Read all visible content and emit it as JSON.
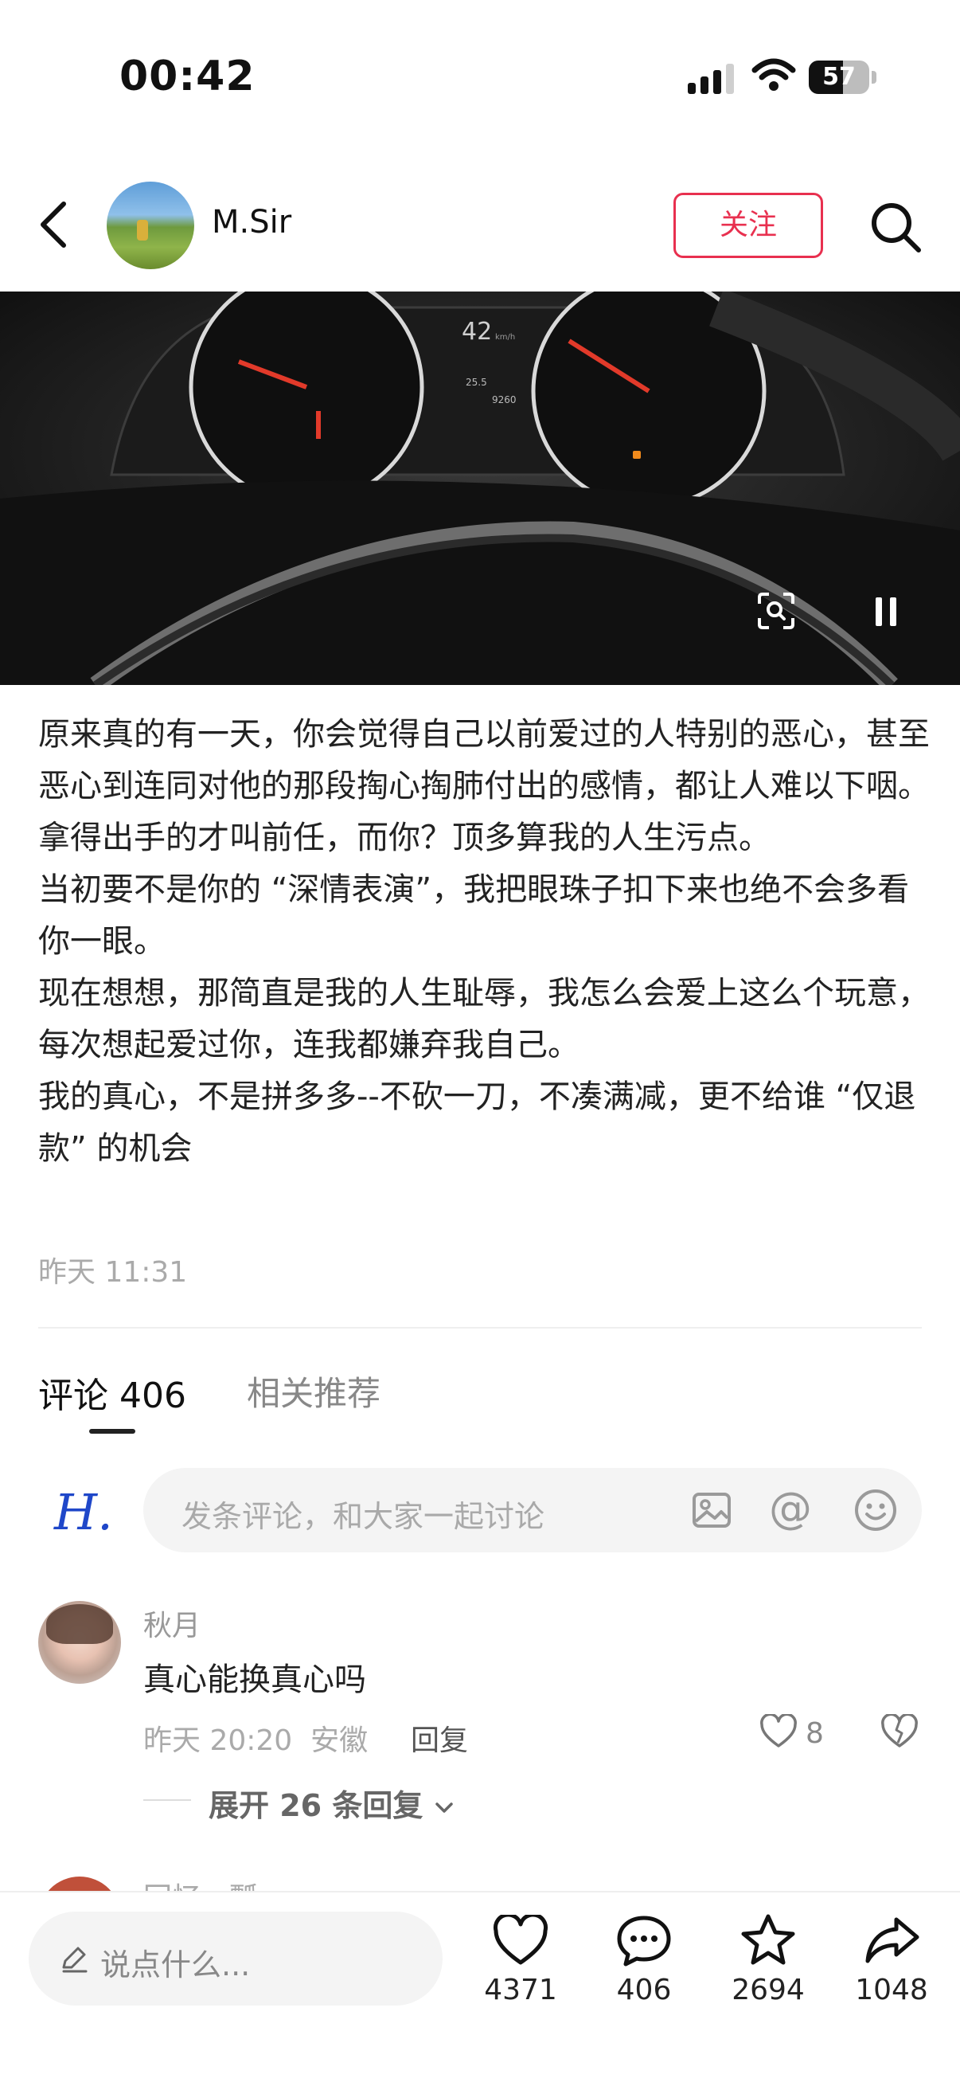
{
  "status_bar": {
    "time": "00:42",
    "battery": "57",
    "battery_level": 0.57
  },
  "header": {
    "author": "M.Sir",
    "follow_label": "关注"
  },
  "media": {
    "speed": "42",
    "speed_unit": "km/h",
    "temp": "25.5",
    "odometer": "9260"
  },
  "post": {
    "paragraphs": [
      "原来真的有一天，你会觉得自己以前爱过的人特别的恶心，甚至恶心到连同对他的那段掏心掏肺付出的感情，都让人难以下咽。 拿得出手的才叫前任，而你？顶多算我的人生污点。",
      "当初要不是你的 “深情表演”，我把眼珠子扣下来也绝不会多看你一眼。",
      "现在想想，那简直是我的人生耻辱，我怎么会爱上这么个玩意，每次想起爱过你，连我都嫌弃我自己。",
      "我的真心，不是拼多多--不砍一刀，不凑满减，更不给谁 “仅退款” 的机会"
    ],
    "time": "昨天 11:31"
  },
  "tabs": {
    "comments": "评论 406",
    "related": "相关推荐"
  },
  "comment_input": {
    "user_logo": "H.",
    "placeholder": "发条评论，和大家一起讨论",
    "at": "@"
  },
  "comments": [
    {
      "user": "秋月",
      "text": "真心能换真心吗",
      "meta": "昨天 20:20  安徽",
      "reply": "回复",
      "likes": "8",
      "expand": "展开 26 条回复"
    }
  ],
  "next_comment": {
    "user": "回忆一瓢"
  },
  "bottom_bar": {
    "say_placeholder": "说点什么...",
    "likes": "4371",
    "comments": "406",
    "favorites": "2694",
    "shares": "1048"
  }
}
